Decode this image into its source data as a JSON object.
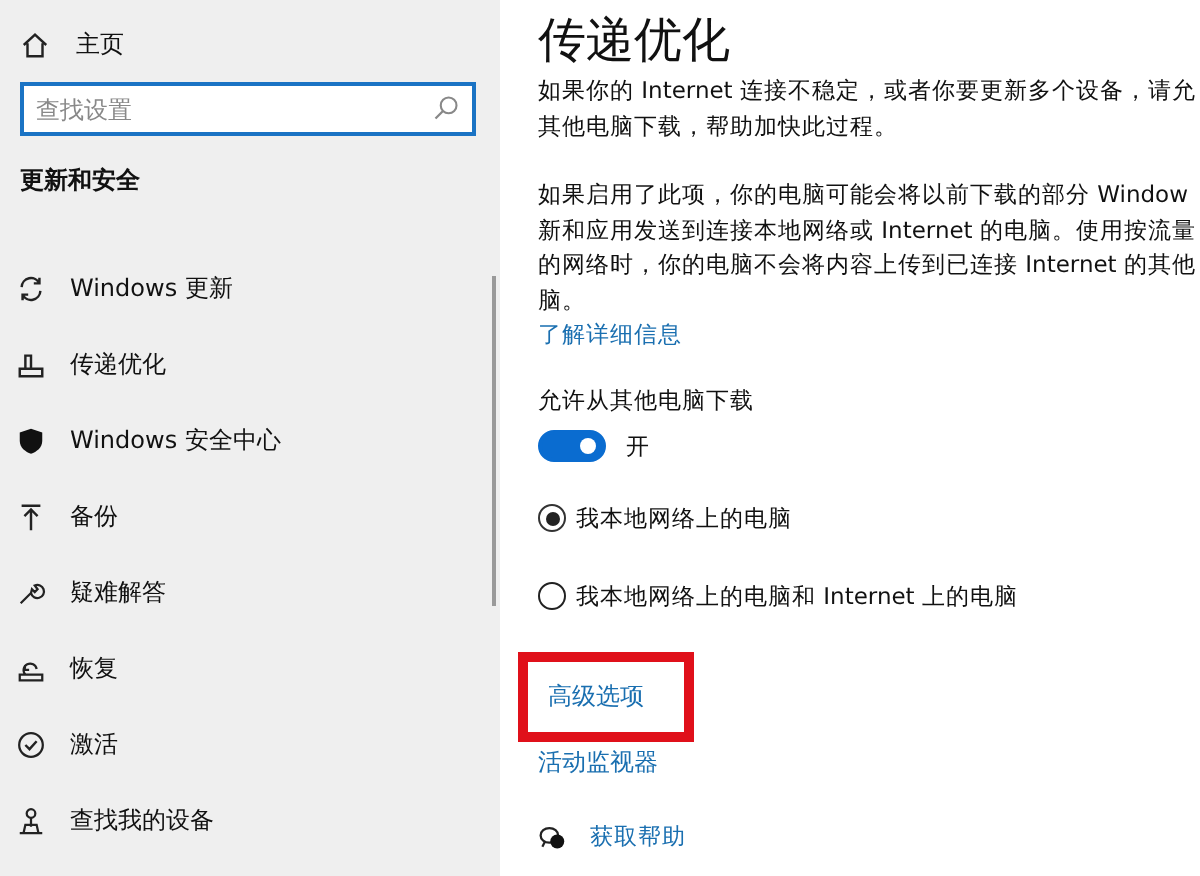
{
  "sidebar": {
    "home": {
      "label": "主页"
    },
    "search": {
      "placeholder": "查找设置"
    },
    "heading": "更新和安全",
    "items": [
      {
        "label": "Windows 更新"
      },
      {
        "label": "传递优化"
      },
      {
        "label": "Windows 安全中心"
      },
      {
        "label": "备份"
      },
      {
        "label": "疑难解答"
      },
      {
        "label": "恢复"
      },
      {
        "label": "激活"
      },
      {
        "label": "查找我的设备"
      }
    ]
  },
  "main": {
    "title": "传递优化",
    "paragraphs": [
      [
        "如果你的 Internet 连接不稳定，或者你要更新多个设备，请允",
        "其他电脑下载，帮助加快此过程。"
      ],
      [
        "如果启用了此项，你的电脑可能会将以前下载的部分 Window",
        "新和应用发送到连接本地网络或 Internet 的电脑。使用按流量",
        "的网络时，你的电脑不会将内容上传到已连接 Internet 的其他",
        "脑。"
      ]
    ],
    "learn_more": "了解详细信息",
    "toggle": {
      "label": "允许从其他电脑下载",
      "on": true,
      "state_text": "开"
    },
    "radios": [
      {
        "label": "我本地网络上的电脑",
        "selected": true
      },
      {
        "label": "我本地网络上的电脑和 Internet 上的电脑",
        "selected": false
      }
    ],
    "links": [
      {
        "label": "高级选项",
        "highlighted": true
      },
      {
        "label": "活动监视器",
        "highlighted": false
      }
    ],
    "help": "获取帮助"
  }
}
